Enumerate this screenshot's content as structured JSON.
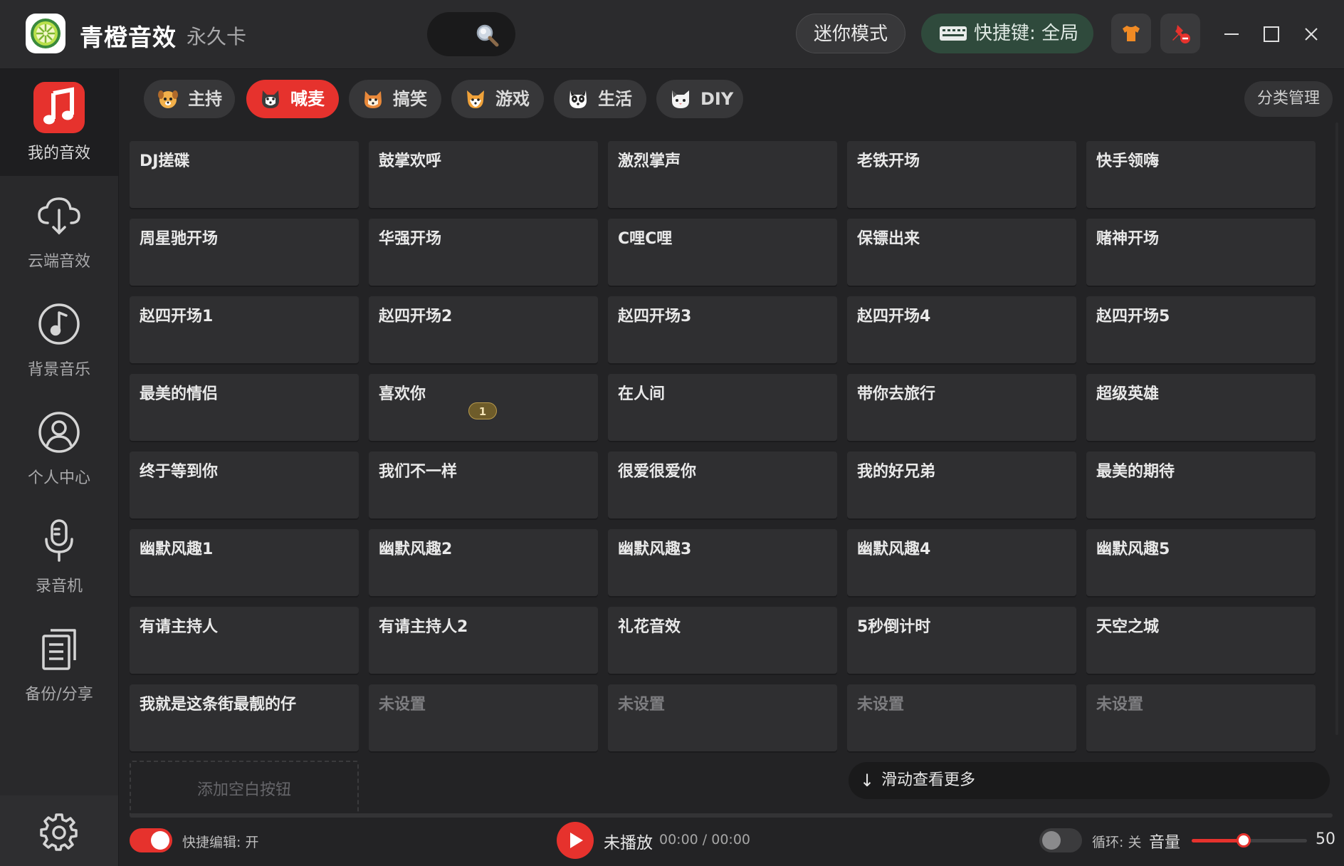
{
  "header": {
    "app_name": "青橙音效",
    "license": "永久卡",
    "mini_mode": "迷你模式",
    "hotkey": "快捷键: 全局"
  },
  "sidebar": {
    "items": [
      {
        "label": "我的音效",
        "icon": "music-note-icon",
        "active": true
      },
      {
        "label": "云端音效",
        "icon": "cloud-download-icon"
      },
      {
        "label": "背景音乐",
        "icon": "music-disc-icon"
      },
      {
        "label": "个人中心",
        "icon": "user-icon"
      },
      {
        "label": "录音机",
        "icon": "microphone-icon"
      },
      {
        "label": "备份/分享",
        "icon": "document-copy-icon"
      }
    ]
  },
  "tabs": [
    {
      "label": "主持",
      "icon": "dog-face-icon"
    },
    {
      "label": "喊麦",
      "icon": "husky-face-icon",
      "active": true
    },
    {
      "label": "搞笑",
      "icon": "shiba-face-icon"
    },
    {
      "label": "游戏",
      "icon": "fox-face-icon"
    },
    {
      "label": "生活",
      "icon": "panda-dog-face-icon"
    },
    {
      "label": "DIY",
      "icon": "cat-face-icon"
    }
  ],
  "manage_label": "分类管理",
  "sounds": [
    [
      "DJ搓碟",
      "鼓掌欢呼",
      "激烈掌声",
      "老铁开场",
      "快手领嗨"
    ],
    [
      "周星驰开场",
      "华强开场",
      "C哩C哩",
      "保镖出来",
      "赌神开场"
    ],
    [
      "赵四开场1",
      "赵四开场2",
      "赵四开场3",
      "赵四开场4",
      "赵四开场5"
    ],
    [
      "最美的情侣",
      "喜欢你",
      "在人间",
      "带你去旅行",
      "超级英雄"
    ],
    [
      "终于等到你",
      "我们不一样",
      "很爱很爱你",
      "我的好兄弟",
      "最美的期待"
    ],
    [
      "幽默风趣1",
      "幽默风趣2",
      "幽默风趣3",
      "幽默风趣4",
      "幽默风趣5"
    ],
    [
      "有请主持人",
      "有请主持人2",
      "礼花音效",
      "5秒倒计时",
      "天空之城"
    ],
    [
      "我就是这条街最靓的仔",
      "未设置",
      "未设置",
      "未设置",
      "未设置"
    ]
  ],
  "badge": "1",
  "add_blank": "添加空白按钮",
  "scroll_more": "滑动查看更多",
  "footer": {
    "quick_edit": "快捷编辑: 开",
    "status": "未播放",
    "time": "00:00 / 00:00",
    "loop": "循环: 关",
    "volume_label": "音量",
    "volume_value": "50",
    "volume_fraction": 0.5
  },
  "colors": {
    "accent": "#e6322d",
    "background": "#232325",
    "cell": "#2f2f31"
  }
}
